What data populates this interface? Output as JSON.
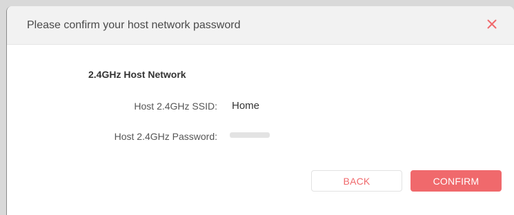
{
  "dialog": {
    "title": "Please confirm your host network password",
    "close_icon": "close-icon"
  },
  "section": {
    "title": "2.4GHz Host Network"
  },
  "fields": {
    "ssid_label": "Host 2.4GHz SSID:",
    "ssid_value": "Home",
    "password_label": "Host 2.4GHz Password:"
  },
  "buttons": {
    "back_label": "BACK",
    "confirm_label": "CONFIRM"
  },
  "colors": {
    "accent": "#f0696c",
    "header_bg": "#f2f2f2",
    "close_icon": "#f0696c"
  }
}
